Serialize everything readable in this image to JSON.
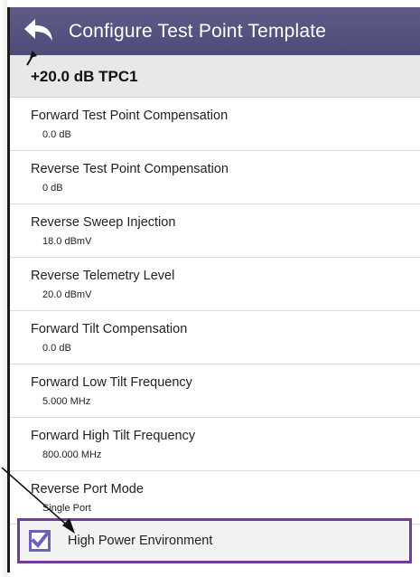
{
  "title_bar": {
    "title": "Configure Test Point Template",
    "back_icon": "back-arrow-icon"
  },
  "template": {
    "name": "+20.0 dB TPC1"
  },
  "settings": [
    {
      "label": "Forward Test Point Compensation",
      "value": "0.0 dB"
    },
    {
      "label": "Reverse Test Point Compensation",
      "value": "0 dB"
    },
    {
      "label": "Reverse Sweep Injection",
      "value": "18.0 dBmV"
    },
    {
      "label": "Reverse Telemetry Level",
      "value": "20.0 dBmV"
    },
    {
      "label": "Forward Tilt Compensation",
      "value": "0.0 dB"
    },
    {
      "label": "Forward Low Tilt Frequency",
      "value": "5.000 MHz"
    },
    {
      "label": "Forward High Tilt Frequency",
      "value": "800.000 MHz"
    },
    {
      "label": "Reverse Port Mode",
      "value": "Single Port"
    }
  ],
  "high_power": {
    "label": "High Power Environment",
    "checked": true,
    "icon": "checkbox-checked-icon"
  },
  "colors": {
    "title_bar": "#56527f",
    "highlight_border": "#6d3da1",
    "checkbox": "#6b62b6",
    "header_background": "#e8e8e8"
  }
}
